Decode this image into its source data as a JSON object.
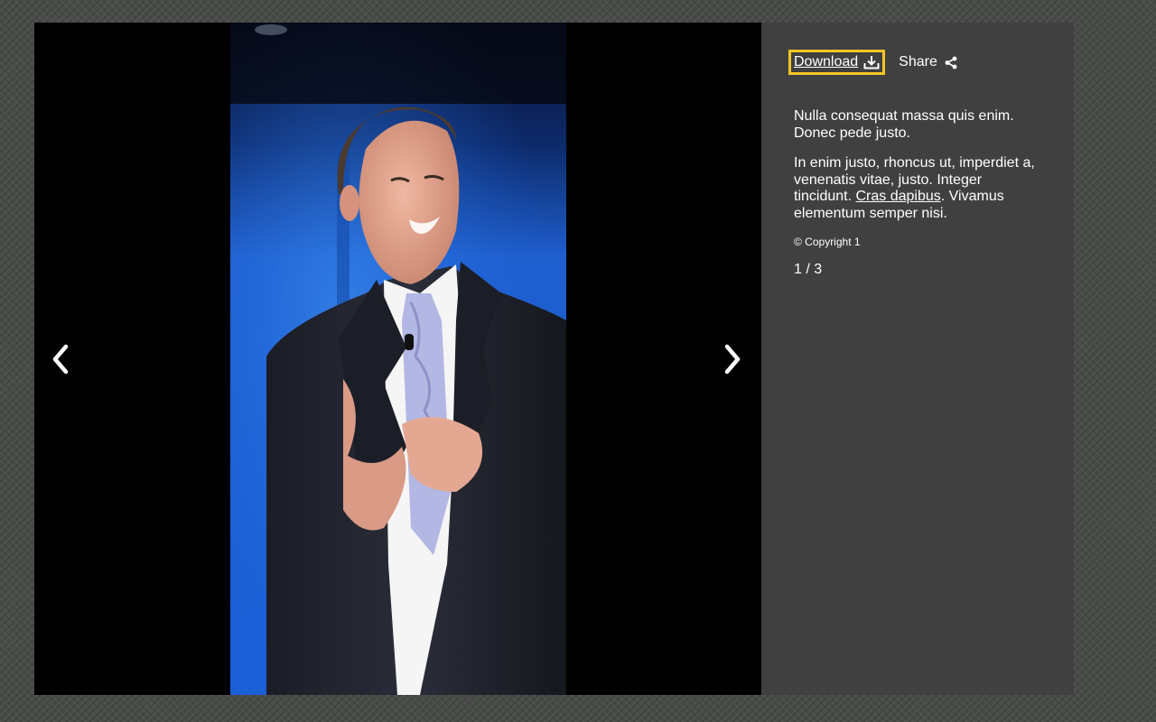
{
  "lightbox": {
    "prev_icon": "chevron-left-icon",
    "next_icon": "chevron-right-icon",
    "photo_subject": "man in pinstripe suit speaking on stage"
  },
  "sidebar": {
    "download_label": "Download",
    "download_icon": "download-icon",
    "share_label": "Share",
    "share_icon": "share-icon",
    "caption_p1": "Nulla consequat massa quis enim. Donec pede justo.",
    "caption_p2_before": "In enim justo, rhoncus ut, imperdiet a, venenatis vitae, justo. Integer tincidunt. ",
    "caption_p2_link": "Cras dapibus",
    "caption_p2_after": ". Vivamus elementum semper nisi.",
    "copyright": "© Copyright 1",
    "counter": "1 / 3"
  },
  "colors": {
    "focus_outline": "#f3c623",
    "sidebar_bg": "#404040",
    "stage_bg": "#000000"
  }
}
